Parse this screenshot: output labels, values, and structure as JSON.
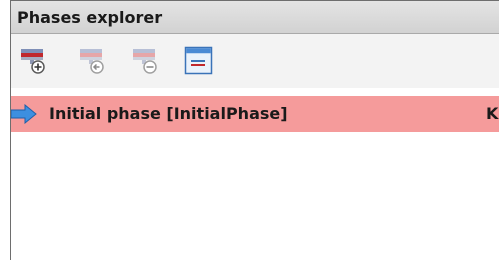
{
  "panel": {
    "title": "Phases explorer"
  },
  "toolbar": {
    "buttons": [
      {
        "name": "add-phase",
        "icon": "table-add-icon"
      },
      {
        "name": "insert-phase",
        "icon": "table-insert-icon"
      },
      {
        "name": "delete-phase",
        "icon": "table-remove-icon"
      },
      {
        "name": "phase-properties",
        "icon": "window-properties-icon"
      }
    ]
  },
  "phases": [
    {
      "label": "Initial phase [InitialPhase]",
      "extra": "K",
      "selected": true,
      "icon": "arrow-right-icon"
    }
  ],
  "colors": {
    "selection": "#f59b9b",
    "arrow": "#3d8fe0",
    "icon_red": "#c0282d"
  }
}
